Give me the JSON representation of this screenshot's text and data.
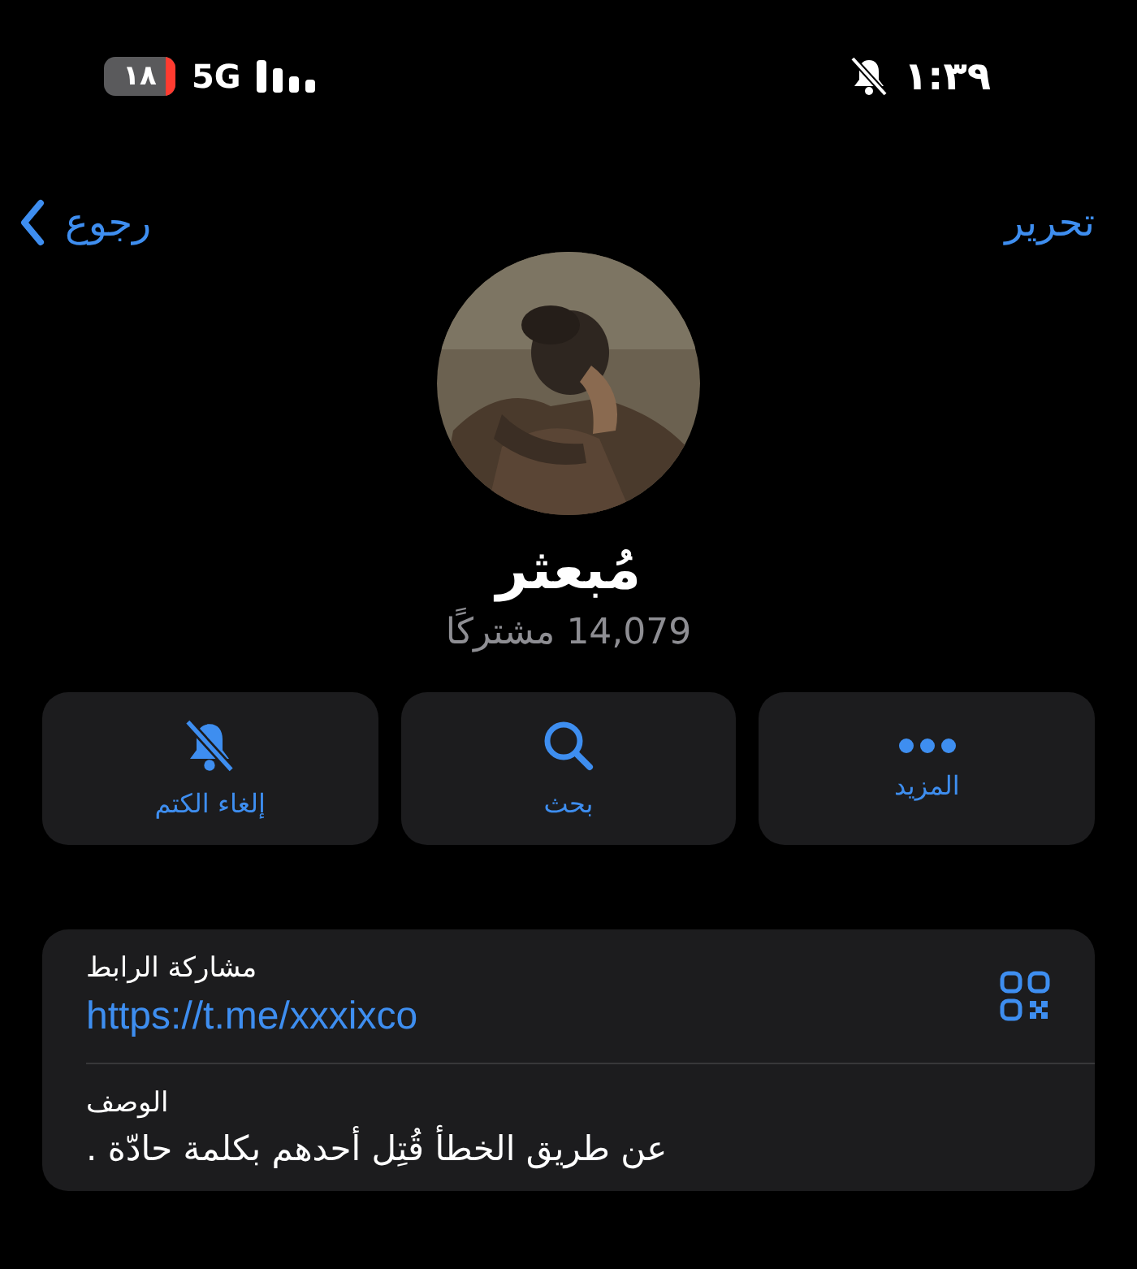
{
  "status_bar": {
    "battery": "١٨",
    "network": "5G",
    "muted": true,
    "time": "١:٣٩"
  },
  "nav": {
    "back": "رجوع",
    "edit": "تحرير"
  },
  "channel": {
    "name": "مُبعثر",
    "subscribers": "14,079 مشتركًا"
  },
  "actions": [
    {
      "kind": "more",
      "label": "المزيد"
    },
    {
      "kind": "search",
      "label": "بحث"
    },
    {
      "kind": "unmute",
      "label": "إلغاء الكتم"
    }
  ],
  "info": [
    {
      "kind": "link",
      "label": "مشاركة الرابط",
      "value": "https://t.me/xxxixco"
    },
    {
      "kind": "text",
      "label": "الوصف",
      "value": "عن طريق الخطأ قُتِل أحدهم بكلمة حادّة ."
    }
  ]
}
